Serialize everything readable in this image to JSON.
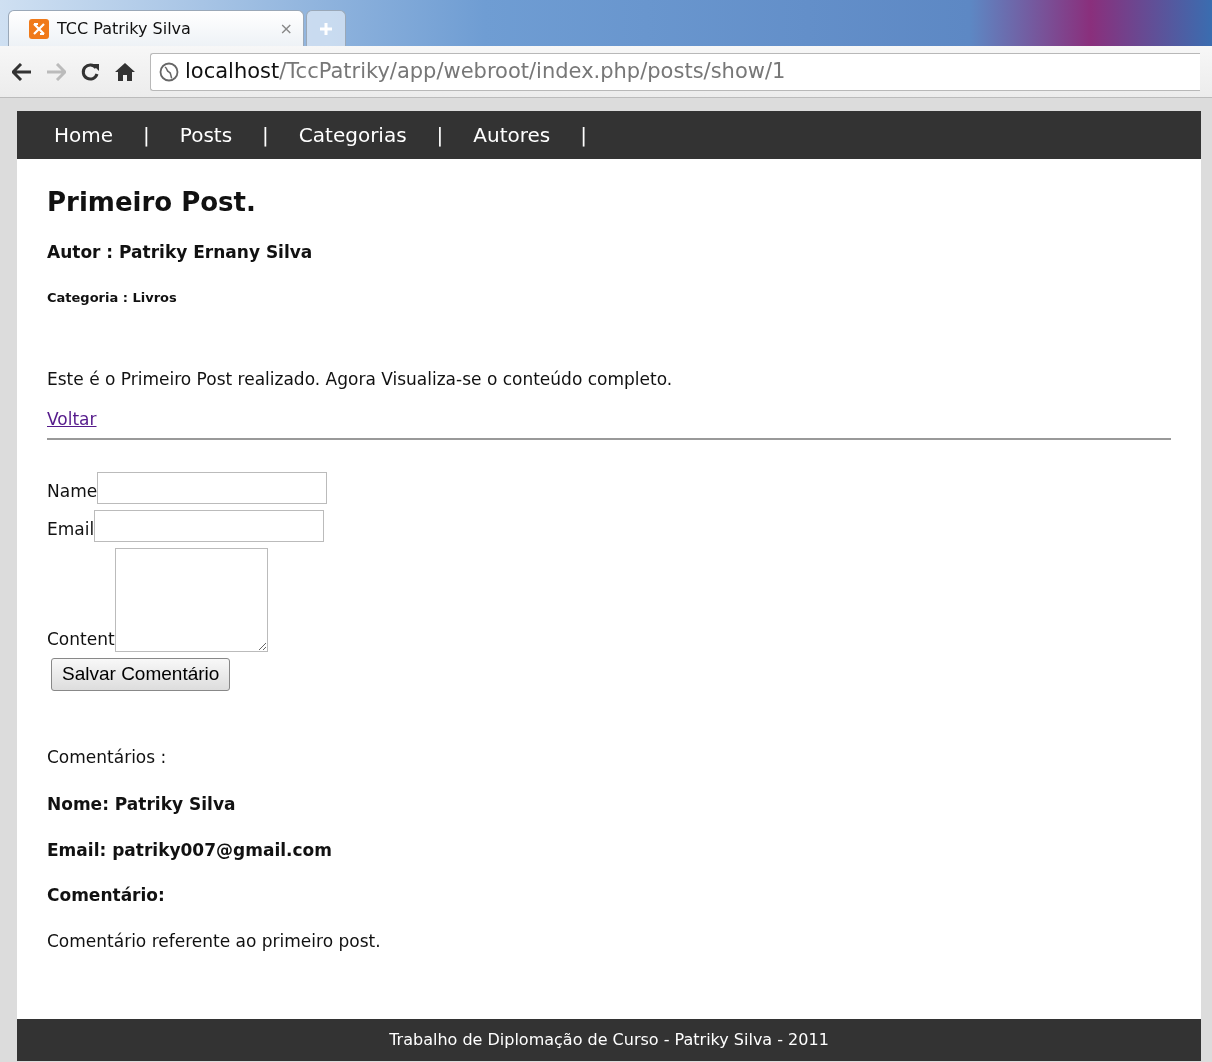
{
  "browser": {
    "tabs": [
      {
        "title": "TCC Patriky Silva",
        "selected": true,
        "close": "×"
      },
      {
        "selected": false
      }
    ],
    "address": {
      "host": "localhost",
      "path": "/TccPatriky/app/webroot/index.php/posts/show/1"
    }
  },
  "nav": {
    "separator": "|",
    "items": [
      {
        "label": "Home"
      },
      {
        "label": "Posts"
      },
      {
        "label": "Categorias"
      },
      {
        "label": "Autores"
      }
    ]
  },
  "post": {
    "title": "Primeiro Post.",
    "author": "Autor : Patriky Ernany Silva",
    "category": "Categoria : Livros",
    "body": "Este é o Primeiro Post realizado. Agora Visualiza-se o conteúdo completo.",
    "back_link": "Voltar"
  },
  "form": {
    "fields": [
      {
        "label": "Name",
        "kind": "input"
      },
      {
        "label": "Email",
        "kind": "input"
      },
      {
        "label": "Content",
        "kind": "textarea"
      }
    ],
    "submit": "Salvar Comentário"
  },
  "comments": {
    "heading": "Comentários :",
    "items": [
      {
        "name": "Nome: Patriky Silva",
        "email": "Email: patriky007@gmail.com",
        "label": "Comentário:",
        "text": "Comentário referente ao primeiro post."
      }
    ]
  },
  "footer": "Trabalho de Diplomação de Curso - Patriky Silva - 2011"
}
